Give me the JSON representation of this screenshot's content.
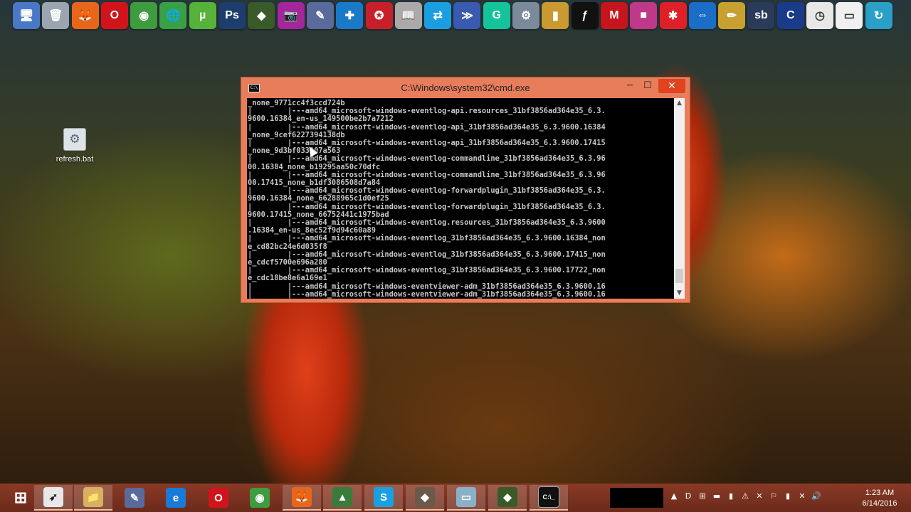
{
  "top_bar_icons": [
    {
      "name": "computer-icon",
      "color": "#4a78c8",
      "glyph": "🖥"
    },
    {
      "name": "recycle-bin-icon",
      "color": "#9aa5b0",
      "glyph": "🗑"
    },
    {
      "name": "firefox-icon",
      "color": "#e8661a",
      "glyph": "🦊"
    },
    {
      "name": "opera-icon",
      "color": "#d1141c",
      "glyph": "O"
    },
    {
      "name": "chrome-icon",
      "color": "#3e9b3e",
      "glyph": "◉"
    },
    {
      "name": "globe-icon",
      "color": "#3aa047",
      "glyph": "🌐"
    },
    {
      "name": "utorrent-icon",
      "color": "#56b23a",
      "glyph": "µ"
    },
    {
      "name": "photoshop-icon",
      "color": "#1d3d6e",
      "glyph": "Ps"
    },
    {
      "name": "app-icon",
      "color": "#3a5a2a",
      "glyph": "◆"
    },
    {
      "name": "camera-icon",
      "color": "#a3279b",
      "glyph": "📷"
    },
    {
      "name": "tool-icon",
      "color": "#5a6a9a",
      "glyph": "✎"
    },
    {
      "name": "toolbox-icon",
      "color": "#1a7ac8",
      "glyph": "✚"
    },
    {
      "name": "award-icon",
      "color": "#c8202a",
      "glyph": "✪"
    },
    {
      "name": "manual-icon",
      "color": "#aaaaaa",
      "glyph": "📖"
    },
    {
      "name": "share-icon",
      "color": "#1a9ee0",
      "glyph": "⇄"
    },
    {
      "name": "speed-icon",
      "color": "#3a5ab0",
      "glyph": "≫"
    },
    {
      "name": "grammarly-icon",
      "color": "#15c39a",
      "glyph": "G"
    },
    {
      "name": "settings-icon",
      "color": "#7a8a9a",
      "glyph": "⚙"
    },
    {
      "name": "book-icon",
      "color": "#c89a30",
      "glyph": "▮"
    },
    {
      "name": "flash-icon",
      "color": "#111111",
      "glyph": "ƒ"
    },
    {
      "name": "mcafee-icon",
      "color": "#c8141c",
      "glyph": "M"
    },
    {
      "name": "app-pink-icon",
      "color": "#c0388a",
      "glyph": "■"
    },
    {
      "name": "pinwheel-icon",
      "color": "#e02028",
      "glyph": "✱"
    },
    {
      "name": "teamviewer-icon",
      "color": "#1a6ec8",
      "glyph": "⇔"
    },
    {
      "name": "pencil-icon",
      "color": "#c8a030",
      "glyph": "✏"
    },
    {
      "name": "sb-icon",
      "color": "#2a3a5a",
      "glyph": "sb"
    },
    {
      "name": "ccleaner-icon",
      "color": "#1a3a8a",
      "glyph": "C"
    },
    {
      "name": "clock-icon",
      "color": "#e8e8e8",
      "glyph": "◷"
    },
    {
      "name": "folder-icon",
      "color": "#f0f0f0",
      "glyph": "▭"
    },
    {
      "name": "refresh-icon",
      "color": "#2aa0c8",
      "glyph": "↻"
    }
  ],
  "desktop": {
    "icon_label": "refresh.bat"
  },
  "cmd_window": {
    "title": "C:\\Windows\\system32\\cmd.exe",
    "minimize": "─",
    "maximize": "☐",
    "close": "✕",
    "console_lines": [
      "_none_9771cc4f3ccd724b",
      "|        |---amd64_microsoft-windows-eventlog-api.resources_31bf3856ad364e35_6.3.",
      "9600.16384_en-us_149500be2b7a7212",
      "|        |---amd64_microsoft-windows-eventlog-api_31bf3856ad364e35_6.3.9600.16384",
      "_none_9cef6227394138db",
      "|        |---amd64_microsoft-windows-eventlog-api_31bf3856ad364e35_6.3.9600.17415",
      "_none_9d3bf033907a563",
      "|        |---amd64_microsoft-windows-eventlog-commandline_31bf3856ad364e35_6.3.96",
      "00.16384_none_b19295aa50c70dfc",
      "|        |---amd64_microsoft-windows-eventlog-commandline_31bf3856ad364e35_6.3.96",
      "00.17415_none_b1df3086508d7a84",
      "|        |---amd64_microsoft-windows-eventlog-forwardplugin_31bf3856ad364e35_6.3.",
      "9600.16384_none_66288965c1d0ef25",
      "|        |---amd64_microsoft-windows-eventlog-forwardplugin_31bf3856ad364e35_6.3.",
      "9600.17415_none_66752441c1975bad",
      "|        |---amd64_microsoft-windows-eventlog.resources_31bf3856ad364e35_6.3.9600",
      ".16384_en-us_8ec52f9d94c60a89",
      "|        |---amd64_microsoft-windows-eventlog_31bf3856ad364e35_6.3.9600.16384_non",
      "e_cd82bc24e6d035f8",
      "|        |---amd64_microsoft-windows-eventlog_31bf3856ad364e35_6.3.9600.17415_non",
      "e_cdcf5700e696a280",
      "|        |---amd64_microsoft-windows-eventlog_31bf3856ad364e35_6.3.9600.17722_non",
      "e_cdc18be8e6a169e1",
      "|        |---amd64_microsoft-windows-eventviewer-adm_31bf3856ad364e35_6.3.9600.16",
      "|        |---amd64_microsoft-windows-eventviewer-adm_31bf3856ad364e35_6.3.9600.16"
    ],
    "scroll_up": "▲",
    "scroll_down": "▼"
  },
  "taskbar": {
    "items": [
      {
        "name": "start-button",
        "glyph": "⊞",
        "color": "transparent",
        "active": false
      },
      {
        "name": "taskbar-cursor-app",
        "glyph": "➶",
        "color": "#e8e8e8",
        "active": true
      },
      {
        "name": "taskbar-explorer",
        "glyph": "📁",
        "color": "#d8b060",
        "active": true
      },
      {
        "name": "taskbar-tool",
        "glyph": "✎",
        "color": "#5a6a9a",
        "active": false
      },
      {
        "name": "taskbar-ie",
        "glyph": "e",
        "color": "#1a7ad8",
        "active": false
      },
      {
        "name": "taskbar-opera",
        "glyph": "O",
        "color": "#d1141c",
        "active": false
      },
      {
        "name": "taskbar-chrome",
        "glyph": "◉",
        "color": "#3e9b3e",
        "active": false
      },
      {
        "name": "taskbar-firefox",
        "glyph": "🦊",
        "color": "#e8661a",
        "active": true
      },
      {
        "name": "taskbar-chart-app",
        "glyph": "▲",
        "color": "#3a7a3a",
        "active": true
      },
      {
        "name": "taskbar-skype",
        "glyph": "S",
        "color": "#1aa0e0",
        "active": true
      },
      {
        "name": "taskbar-app-red",
        "glyph": "◆",
        "color": "#6a5a4a",
        "active": true
      },
      {
        "name": "taskbar-notes",
        "glyph": "▭",
        "color": "#8ab0c8",
        "active": true
      },
      {
        "name": "taskbar-app-green",
        "glyph": "◆",
        "color": "#3a5a2a",
        "active": true
      },
      {
        "name": "taskbar-cmd",
        "glyph": "C:\\_",
        "color": "#111111",
        "active": true
      }
    ],
    "tray_icons": [
      "▲",
      "D",
      "⊞",
      "▬",
      "▮",
      "⚠",
      "✕",
      "⚐",
      "▮",
      "✕",
      "🔊"
    ],
    "time": "1:23 AM",
    "date": "6/14/2016"
  }
}
